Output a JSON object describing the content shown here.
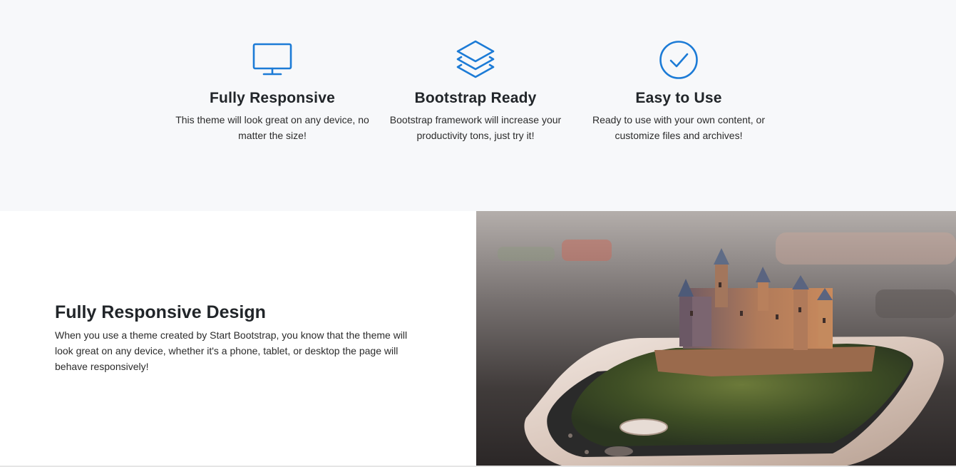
{
  "features": [
    {
      "icon": "monitor-icon",
      "title": "Fully Responsive",
      "text": "This theme will look great on any device, no matter the size!"
    },
    {
      "icon": "layers-icon",
      "title": "Bootstrap Ready",
      "text": "Bootstrap framework will increase your productivity tons, just try it!"
    },
    {
      "icon": "check-circle-icon",
      "title": "Easy to Use",
      "text": "Ready to use with your own content, or customize files and archives!"
    }
  ],
  "showcase": {
    "title": "Fully Responsive Design",
    "text": "When you use a theme created by Start Bootstrap, you know that the theme will look great on any device, whether it's a phone, tablet, or desktop the page will behave responsively!",
    "image": "phone-castle-image"
  },
  "colors": {
    "accent": "#1c7bd6",
    "features_bg": "#f7f8fa",
    "text": "#212529"
  }
}
